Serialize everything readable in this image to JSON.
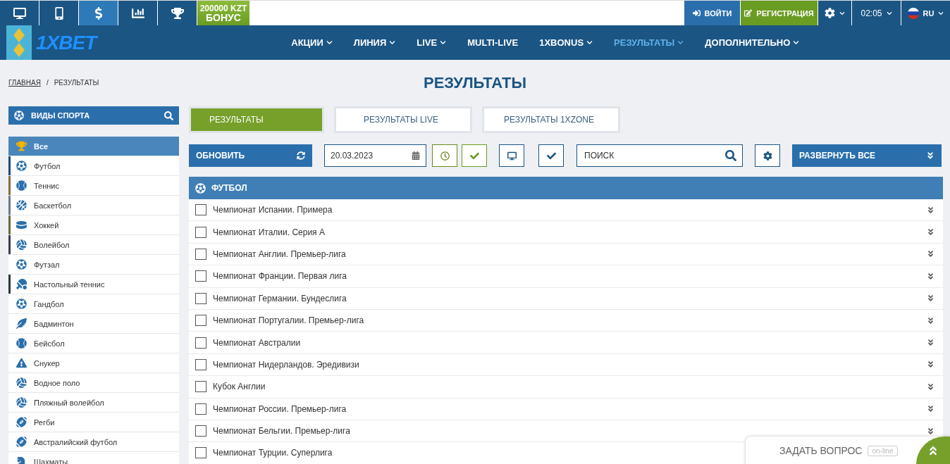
{
  "topbar": {
    "icons_selected": [
      false,
      false,
      true,
      false,
      false
    ],
    "bonus": {
      "amount": "200000 KZT",
      "label": "БОНУС"
    },
    "login": "ВОЙТИ",
    "register": "РЕГИСТРАЦИЯ",
    "time": "02:05",
    "language": "RU"
  },
  "nav": {
    "logo": "1XBET",
    "items": [
      {
        "label": "АКЦИИ",
        "dropdown": true,
        "selected": false
      },
      {
        "label": "ЛИНИЯ",
        "dropdown": true,
        "selected": false
      },
      {
        "label": "LIVE",
        "dropdown": true,
        "selected": false
      },
      {
        "label": "MULTI-LIVE",
        "dropdown": false,
        "selected": false
      },
      {
        "label": "1XBONUS",
        "dropdown": true,
        "selected": false
      },
      {
        "label": "РЕЗУЛЬТАТЫ",
        "dropdown": true,
        "selected": true
      },
      {
        "label": "ДОПОЛНИТЕЛЬНО",
        "dropdown": true,
        "selected": false
      }
    ]
  },
  "breadcrumb": [
    "ГЛАВНАЯ",
    "/",
    "РЕЗУЛЬТАТЫ"
  ],
  "page_title": "РЕЗУЛЬТАТЫ",
  "sidebar": {
    "title": "ВИДЫ СПОРТА",
    "items": [
      {
        "label": "Все",
        "selected": true
      },
      {
        "label": "Футбол",
        "selected": false,
        "color": "#1b4a72"
      },
      {
        "label": "Теннис",
        "selected": false,
        "color": "#8a6a3a"
      },
      {
        "label": "Баскетбол",
        "selected": false,
        "color": "#6b7b8a"
      },
      {
        "label": "Хоккей",
        "selected": false,
        "color": "#6b6a3a"
      },
      {
        "label": "Волейбол",
        "selected": false,
        "color": "#3a3a5a"
      },
      {
        "label": "Футзал",
        "selected": false
      },
      {
        "label": "Настольный теннис",
        "selected": false,
        "color": "#2a3a3a"
      },
      {
        "label": "Гандбол",
        "selected": false
      },
      {
        "label": "Бадминтон",
        "selected": false
      },
      {
        "label": "Бейсбол",
        "selected": false
      },
      {
        "label": "Снукер",
        "selected": false
      },
      {
        "label": "Водное поло",
        "selected": false
      },
      {
        "label": "Пляжный волейбол",
        "selected": false
      },
      {
        "label": "Регби",
        "selected": false
      },
      {
        "label": "Австралийский футбол",
        "selected": false
      },
      {
        "label": "Шахматы",
        "selected": false
      }
    ]
  },
  "tabs": [
    {
      "label": "РЕЗУЛЬТАТЫ",
      "selected": true
    },
    {
      "label": "РЕЗУЛЬТАТЫ LIVE",
      "selected": false
    },
    {
      "label": "РЕЗУЛЬТАТЫ 1XZONE",
      "selected": false
    }
  ],
  "toolbar": {
    "refresh": "ОБНОВИТЬ",
    "date": "20.03.2023",
    "search_placeholder": "ПОИСК",
    "expand_all": "РАЗВЕРНУТЬ ВСЕ"
  },
  "section": {
    "title": "ФУТБОЛ",
    "leagues": [
      {
        "label": "Чемпионат Испании. Примера",
        "checked": false
      },
      {
        "label": "Чемпионат Италии. Серия А",
        "checked": false
      },
      {
        "label": "Чемпионат Англии. Премьер-лига",
        "checked": false
      },
      {
        "label": "Чемпионат Франции. Первая лига",
        "checked": false
      },
      {
        "label": "Чемпионат Германии. Бундеслига",
        "checked": false
      },
      {
        "label": "Чемпионат Португалии. Премьер-лига",
        "checked": false
      },
      {
        "label": "Чемпионат Австралии",
        "checked": false
      },
      {
        "label": "Чемпионат Нидерландов. Эредивизи",
        "checked": false
      },
      {
        "label": "Кубок Англии",
        "checked": false
      },
      {
        "label": "Чемпионат России. Премьер-лига",
        "checked": false
      },
      {
        "label": "Чемпионат Бельгии. Премьер-лига",
        "checked": false
      },
      {
        "label": "Чемпионат Турции. Суперлига",
        "checked": false
      }
    ]
  },
  "chat": {
    "label": "ЗАДАТЬ ВОПРОС",
    "status": "on-line"
  }
}
